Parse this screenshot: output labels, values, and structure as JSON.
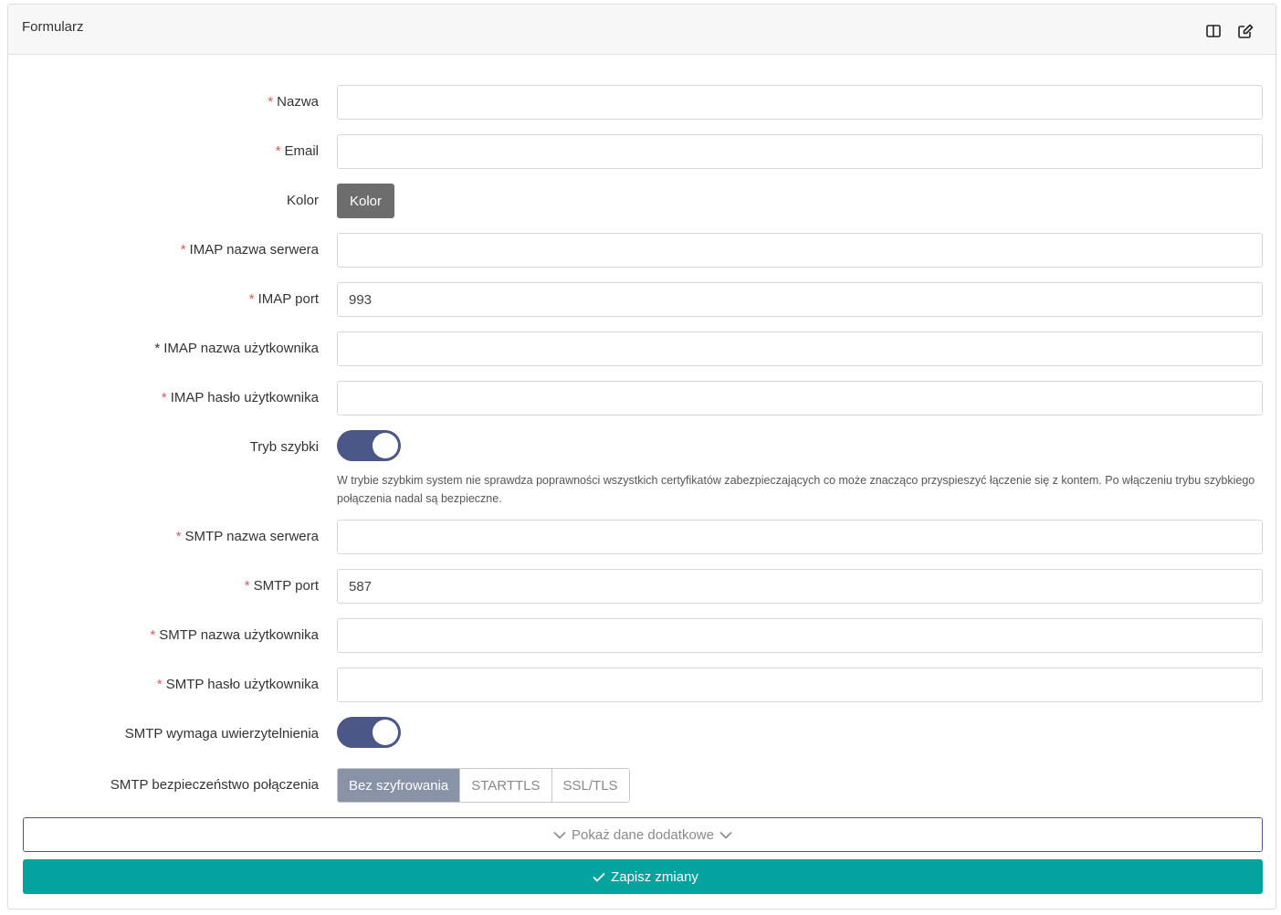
{
  "panel": {
    "title": "Formularz"
  },
  "fields": {
    "nazwa": {
      "label": "Nazwa",
      "required_mark": "*",
      "value": ""
    },
    "email": {
      "label": "Email",
      "required_mark": "*",
      "value": ""
    },
    "kolor": {
      "label": "Kolor",
      "button_label": "Kolor",
      "button_color": "#6d6d6d"
    },
    "imap_server": {
      "label": "IMAP nazwa serwera",
      "required_mark": "*",
      "value": ""
    },
    "imap_port": {
      "label": "IMAP port",
      "required_mark": "*",
      "value": "993"
    },
    "imap_user": {
      "label": "IMAP nazwa użytkownika",
      "required_mark": "*",
      "value": ""
    },
    "imap_password": {
      "label": "IMAP hasło użytkownika",
      "required_mark": "*",
      "value": ""
    },
    "fast_mode": {
      "label": "Tryb szybki",
      "checked": true,
      "help": "W trybie szybkim system nie sprawdza poprawności wszystkich certyfikatów zabezpieczających co może znacząco przyspieszyć łączenie się z kontem. Po włączeniu trybu szybkiego połączenia nadal są bezpieczne."
    },
    "smtp_server": {
      "label": "SMTP nazwa serwera",
      "required_mark": "*",
      "value": ""
    },
    "smtp_port": {
      "label": "SMTP port",
      "required_mark": "*",
      "value": "587"
    },
    "smtp_user": {
      "label": "SMTP nazwa użytkownika",
      "required_mark": "*",
      "value": ""
    },
    "smtp_password": {
      "label": "SMTP hasło użytkownika",
      "required_mark": "*",
      "value": ""
    },
    "smtp_auth": {
      "label": "SMTP wymaga uwierzytelnienia",
      "checked": true
    },
    "smtp_security": {
      "label": "SMTP bezpieczeństwo połączenia",
      "options": [
        "Bez szyfrowania",
        "STARTTLS",
        "SSL/TLS"
      ],
      "selected": "Bez szyfrowania"
    }
  },
  "actions": {
    "show_more_label": "Pokaż dane dodatkowe",
    "save_label": "Zapisz zmiany"
  },
  "colors": {
    "required": "#e05a5a",
    "toggle_on": "#4b5787",
    "save": "#05a39f",
    "segment_active": "#8893a8"
  }
}
